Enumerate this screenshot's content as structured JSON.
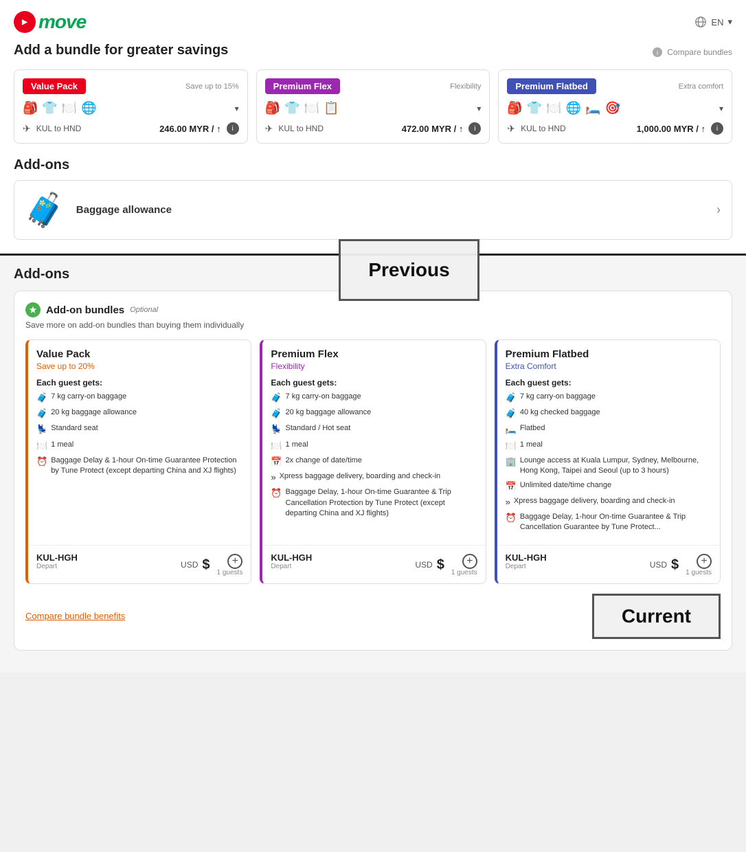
{
  "app": {
    "logo_text": "MOVe",
    "lang": "EN"
  },
  "top": {
    "bundle_title": "Add a bundle for greater savings",
    "compare_label": "Compare bundles",
    "bundles": [
      {
        "badge": "Value Pack",
        "badge_color": "badge-red",
        "subtitle": "Save up to 15%",
        "icons": "🎒 👕 🍽️ 🌐",
        "route": "KUL to HND",
        "price": "246.00 MYR / ↑",
        "border": "left-border-orange"
      },
      {
        "badge": "Premium Flex",
        "badge_color": "badge-purple",
        "subtitle": "Flexibility",
        "icons": "🎒 👕 🍽️ 📋",
        "route": "KUL to HND",
        "price": "472.00 MYR / ↑",
        "border": "left-border-purple"
      },
      {
        "badge": "Premium Flatbed",
        "badge_color": "badge-indigo",
        "subtitle": "Extra comfort",
        "icons": "🎒 👕 🍽️ 🌐 🛏️ 🎯",
        "route": "KUL to HND",
        "price": "1,000.00 MYR / ↑",
        "border": "left-border-indigo"
      }
    ],
    "addons_title": "Add-ons",
    "baggage_label": "Baggage allowance",
    "previous_label": "Previous"
  },
  "bottom": {
    "addons_title": "Add-ons",
    "addon_bundles_title": "Add-on bundles",
    "optional": "Optional",
    "save_text": "Save more on add-on bundles than buying them individually",
    "bundles": [
      {
        "name": "Value Pack",
        "subtitle": "Save up to 20%",
        "subtitle_class": "subtitle-orange",
        "border_class": "left-border-orange",
        "each_guest": "Each guest gets:",
        "features": [
          {
            "icon": "🧳",
            "text": "7 kg carry-on baggage"
          },
          {
            "icon": "🧳",
            "text": "20 kg baggage allowance"
          },
          {
            "icon": "💺",
            "text": "Standard seat"
          },
          {
            "icon": "🍽️",
            "text": "1 meal"
          },
          {
            "icon": "⏰",
            "text": "Baggage Delay & 1-hour On-time Guarantee Protection by Tune Protect (except departing China and XJ flights)"
          }
        ],
        "route": "KUL-HGH",
        "depart": "Depart",
        "currency": "USD",
        "dollar": "$",
        "guests": "1 guests"
      },
      {
        "name": "Premium Flex",
        "subtitle": "Flexibility",
        "subtitle_class": "subtitle-purple",
        "border_class": "left-border-purple",
        "each_guest": "Each guest gets:",
        "features": [
          {
            "icon": "🧳",
            "text": "7 kg carry-on baggage"
          },
          {
            "icon": "🧳",
            "text": "20 kg baggage allowance"
          },
          {
            "icon": "💺",
            "text": "Standard / Hot seat"
          },
          {
            "icon": "🍽️",
            "text": "1 meal"
          },
          {
            "icon": "📅",
            "text": "2x change of date/time"
          },
          {
            "icon": "»",
            "text": "Xpress baggage delivery, boarding and check-in"
          },
          {
            "icon": "⏰",
            "text": "Baggage Delay, 1-hour On-time Guarantee & Trip Cancellation Protection by Tune Protect (except departing China and XJ flights)"
          }
        ],
        "route": "KUL-HGH",
        "depart": "Depart",
        "currency": "USD",
        "dollar": "$",
        "guests": "1 guests"
      },
      {
        "name": "Premium Flatbed",
        "subtitle": "Extra Comfort",
        "subtitle_class": "subtitle-blue",
        "border_class": "left-border-indigo",
        "each_guest": "Each guest gets:",
        "features": [
          {
            "icon": "🧳",
            "text": "7 kg carry-on baggage"
          },
          {
            "icon": "🧳",
            "text": "40 kg checked baggage"
          },
          {
            "icon": "🛏️",
            "text": "Flatbed"
          },
          {
            "icon": "🍽️",
            "text": "1 meal"
          },
          {
            "icon": "🏢",
            "text": "Lounge access at Kuala Lumpur, Sydney, Melbourne, Hong Kong, Taipei and Seoul (up to 3 hours)"
          },
          {
            "icon": "📅",
            "text": "Unlimited date/time change"
          },
          {
            "icon": "»",
            "text": "Xpress baggage delivery, boarding and check-in"
          },
          {
            "icon": "⏰",
            "text": "Baggage Delay, 1-hour On-time Guarantee & Trip Cancellation Guarantee by Tune Protect..."
          }
        ],
        "route": "KUL-HGH",
        "depart": "Depart",
        "currency": "USD",
        "dollar": "$",
        "guests": "1 guests"
      }
    ],
    "compare_link": "Compare bundle benefits",
    "current_label": "Current"
  }
}
